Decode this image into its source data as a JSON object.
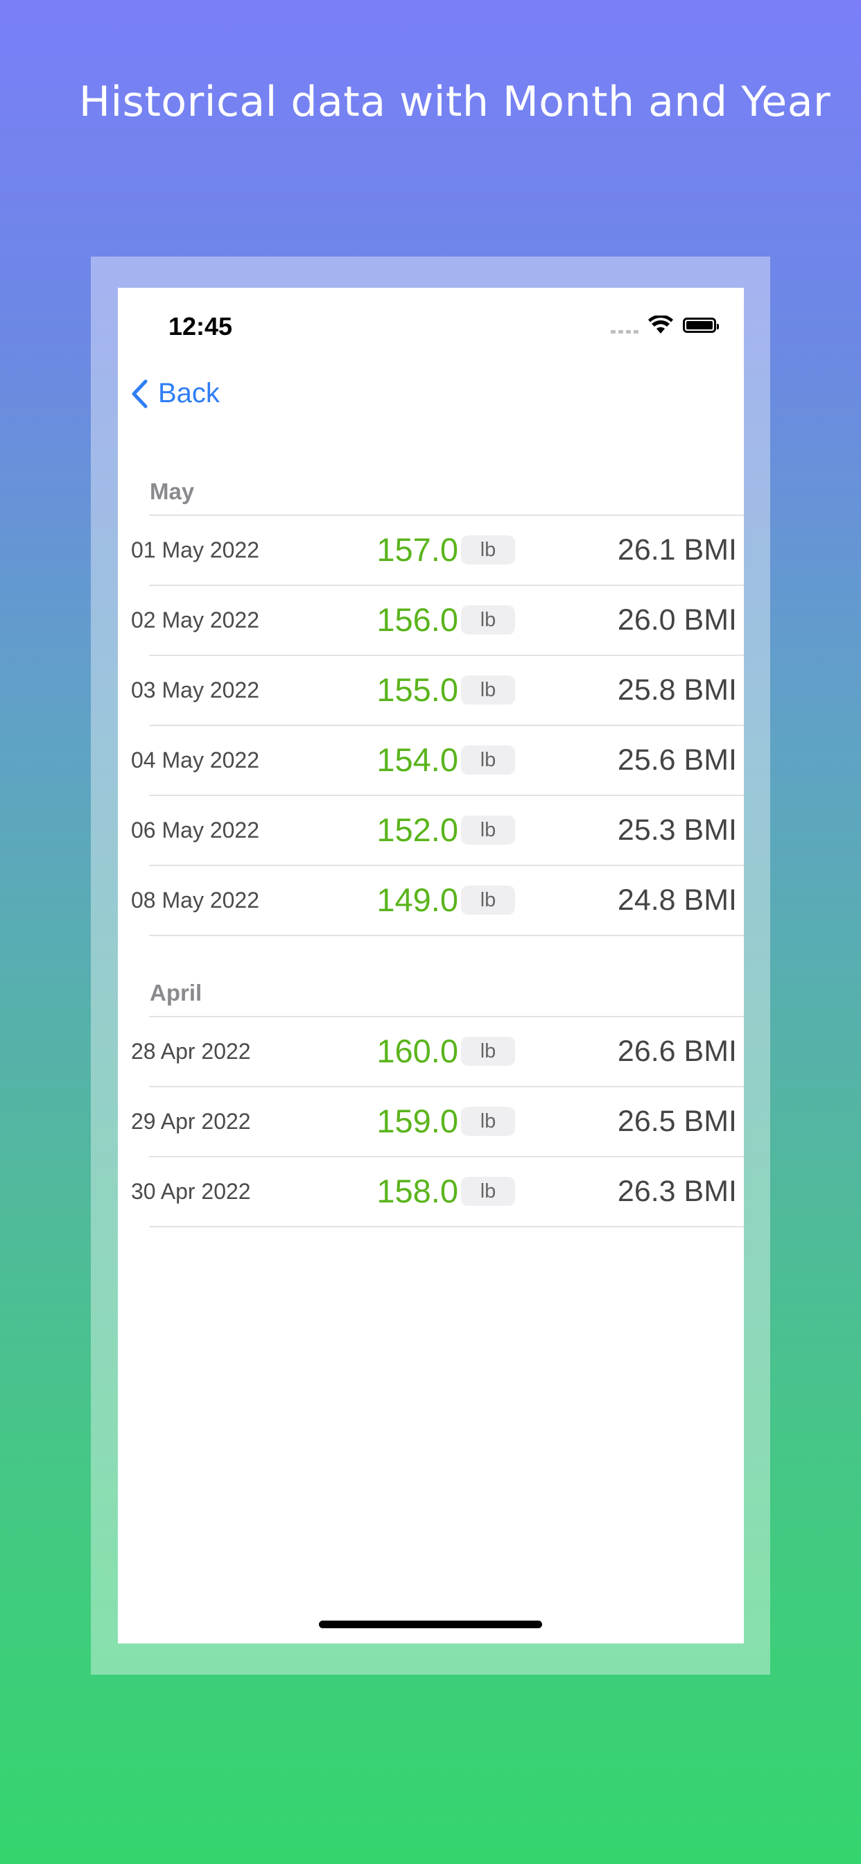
{
  "headline": "Historical data with Month and Year",
  "status_bar": {
    "time": "12:45"
  },
  "nav": {
    "back_label": "Back"
  },
  "sections": [
    {
      "header": "May",
      "rows": [
        {
          "date": "01 May 2022",
          "weight": "157.0",
          "unit": "lb",
          "bmi": "26.1 BMI"
        },
        {
          "date": "02 May 2022",
          "weight": "156.0",
          "unit": "lb",
          "bmi": "26.0 BMI"
        },
        {
          "date": "03 May 2022",
          "weight": "155.0",
          "unit": "lb",
          "bmi": "25.8 BMI"
        },
        {
          "date": "04 May 2022",
          "weight": "154.0",
          "unit": "lb",
          "bmi": "25.6 BMI"
        },
        {
          "date": "06 May 2022",
          "weight": "152.0",
          "unit": "lb",
          "bmi": "25.3 BMI"
        },
        {
          "date": "08 May 2022",
          "weight": "149.0",
          "unit": "lb",
          "bmi": "24.8 BMI"
        }
      ]
    },
    {
      "header": "April",
      "rows": [
        {
          "date": "28 Apr 2022",
          "weight": "160.0",
          "unit": "lb",
          "bmi": "26.6 BMI"
        },
        {
          "date": "29 Apr 2022",
          "weight": "159.0",
          "unit": "lb",
          "bmi": "26.5 BMI"
        },
        {
          "date": "30 Apr 2022",
          "weight": "158.0",
          "unit": "lb",
          "bmi": "26.3 BMI"
        }
      ]
    }
  ],
  "colors": {
    "accent": "#2f7ef5",
    "weight": "#5ab41c",
    "section_header": "#8a8a8e"
  },
  "icons": {
    "back": "chevron-left-icon",
    "signal": "cellular-signal-icon",
    "wifi": "wifi-icon",
    "battery": "battery-icon"
  }
}
